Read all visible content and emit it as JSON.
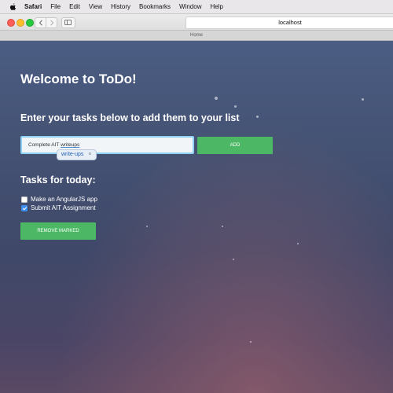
{
  "menubar": {
    "app": "Safari",
    "items": [
      "File",
      "Edit",
      "View",
      "History",
      "Bookmarks",
      "Window",
      "Help"
    ]
  },
  "toolbar": {
    "url": "localhost",
    "back_icon": "chevron-left-icon",
    "forward_icon": "chevron-right-icon"
  },
  "tab": {
    "title": "Home"
  },
  "page": {
    "title": "Welcome to ToDo!",
    "subtitle": "Enter your tasks below to add them to your list",
    "input": {
      "value_prefix": "Complete AIT ",
      "value_misspelled": "writeups",
      "autocorrect_suggestion": "write-ups",
      "autocorrect_dismiss": "×"
    },
    "add_label": "ADD",
    "tasks_heading": "Tasks for today:",
    "tasks": [
      {
        "label": "Make an AngularJS app",
        "checked": false
      },
      {
        "label": "Submit AIT Assignment",
        "checked": true
      }
    ],
    "remove_label": "REMOVE MARKED"
  },
  "colors": {
    "accent_green": "#4cb865",
    "input_focus": "#8ed0f4",
    "checkbox_checked": "#3b8cf0"
  }
}
